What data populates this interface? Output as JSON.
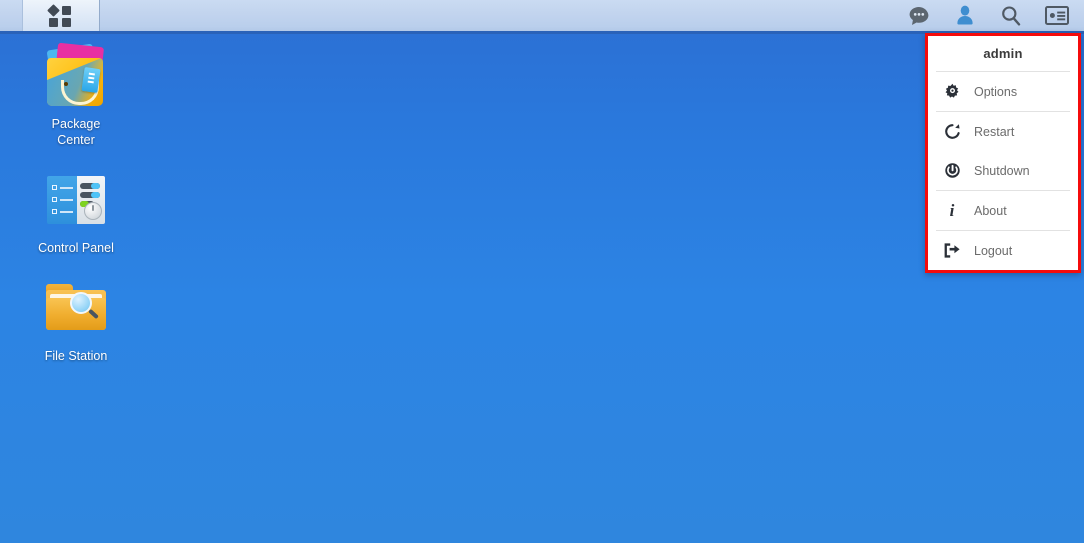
{
  "taskbar": {
    "main_menu_label": "Main Menu",
    "main_menu_icon": "grid-apps-icon",
    "tray_icons": [
      {
        "name": "notifications-icon",
        "label": "Notifications",
        "glyph": "speech-bubble"
      },
      {
        "name": "user-account-icon",
        "label": "admin",
        "glyph": "person"
      },
      {
        "name": "search-icon",
        "label": "Search",
        "glyph": "magnifier"
      },
      {
        "name": "widgets-icon",
        "label": "Widgets",
        "glyph": "card"
      }
    ]
  },
  "desktop": {
    "icons": [
      {
        "name": "package-center",
        "label": "Package\nCenter",
        "icon": "shopping-bag-icon"
      },
      {
        "name": "control-panel",
        "label": "Control Panel",
        "icon": "sliders-panel-icon"
      },
      {
        "name": "file-station",
        "label": "File Station",
        "icon": "folder-search-icon"
      }
    ]
  },
  "admin_menu": {
    "title": "admin",
    "highlighted": true,
    "highlight_color": "#f50b0b",
    "items": [
      {
        "label": "Options",
        "icon": "gear-icon"
      },
      {
        "label": "Restart",
        "icon": "restart-icon"
      },
      {
        "label": "Shutdown",
        "icon": "power-icon"
      },
      {
        "label": "About",
        "icon": "info-icon"
      },
      {
        "label": "Logout",
        "icon": "logout-icon"
      }
    ]
  },
  "colors": {
    "desktop_top": "#2c6ed2",
    "desktop_bottom": "#2f86de",
    "taskbar": "#c2d4ee",
    "taskbar_border": "#2a62b8",
    "highlight": "#f50b0b",
    "menu_text": "#6b6b6b"
  }
}
